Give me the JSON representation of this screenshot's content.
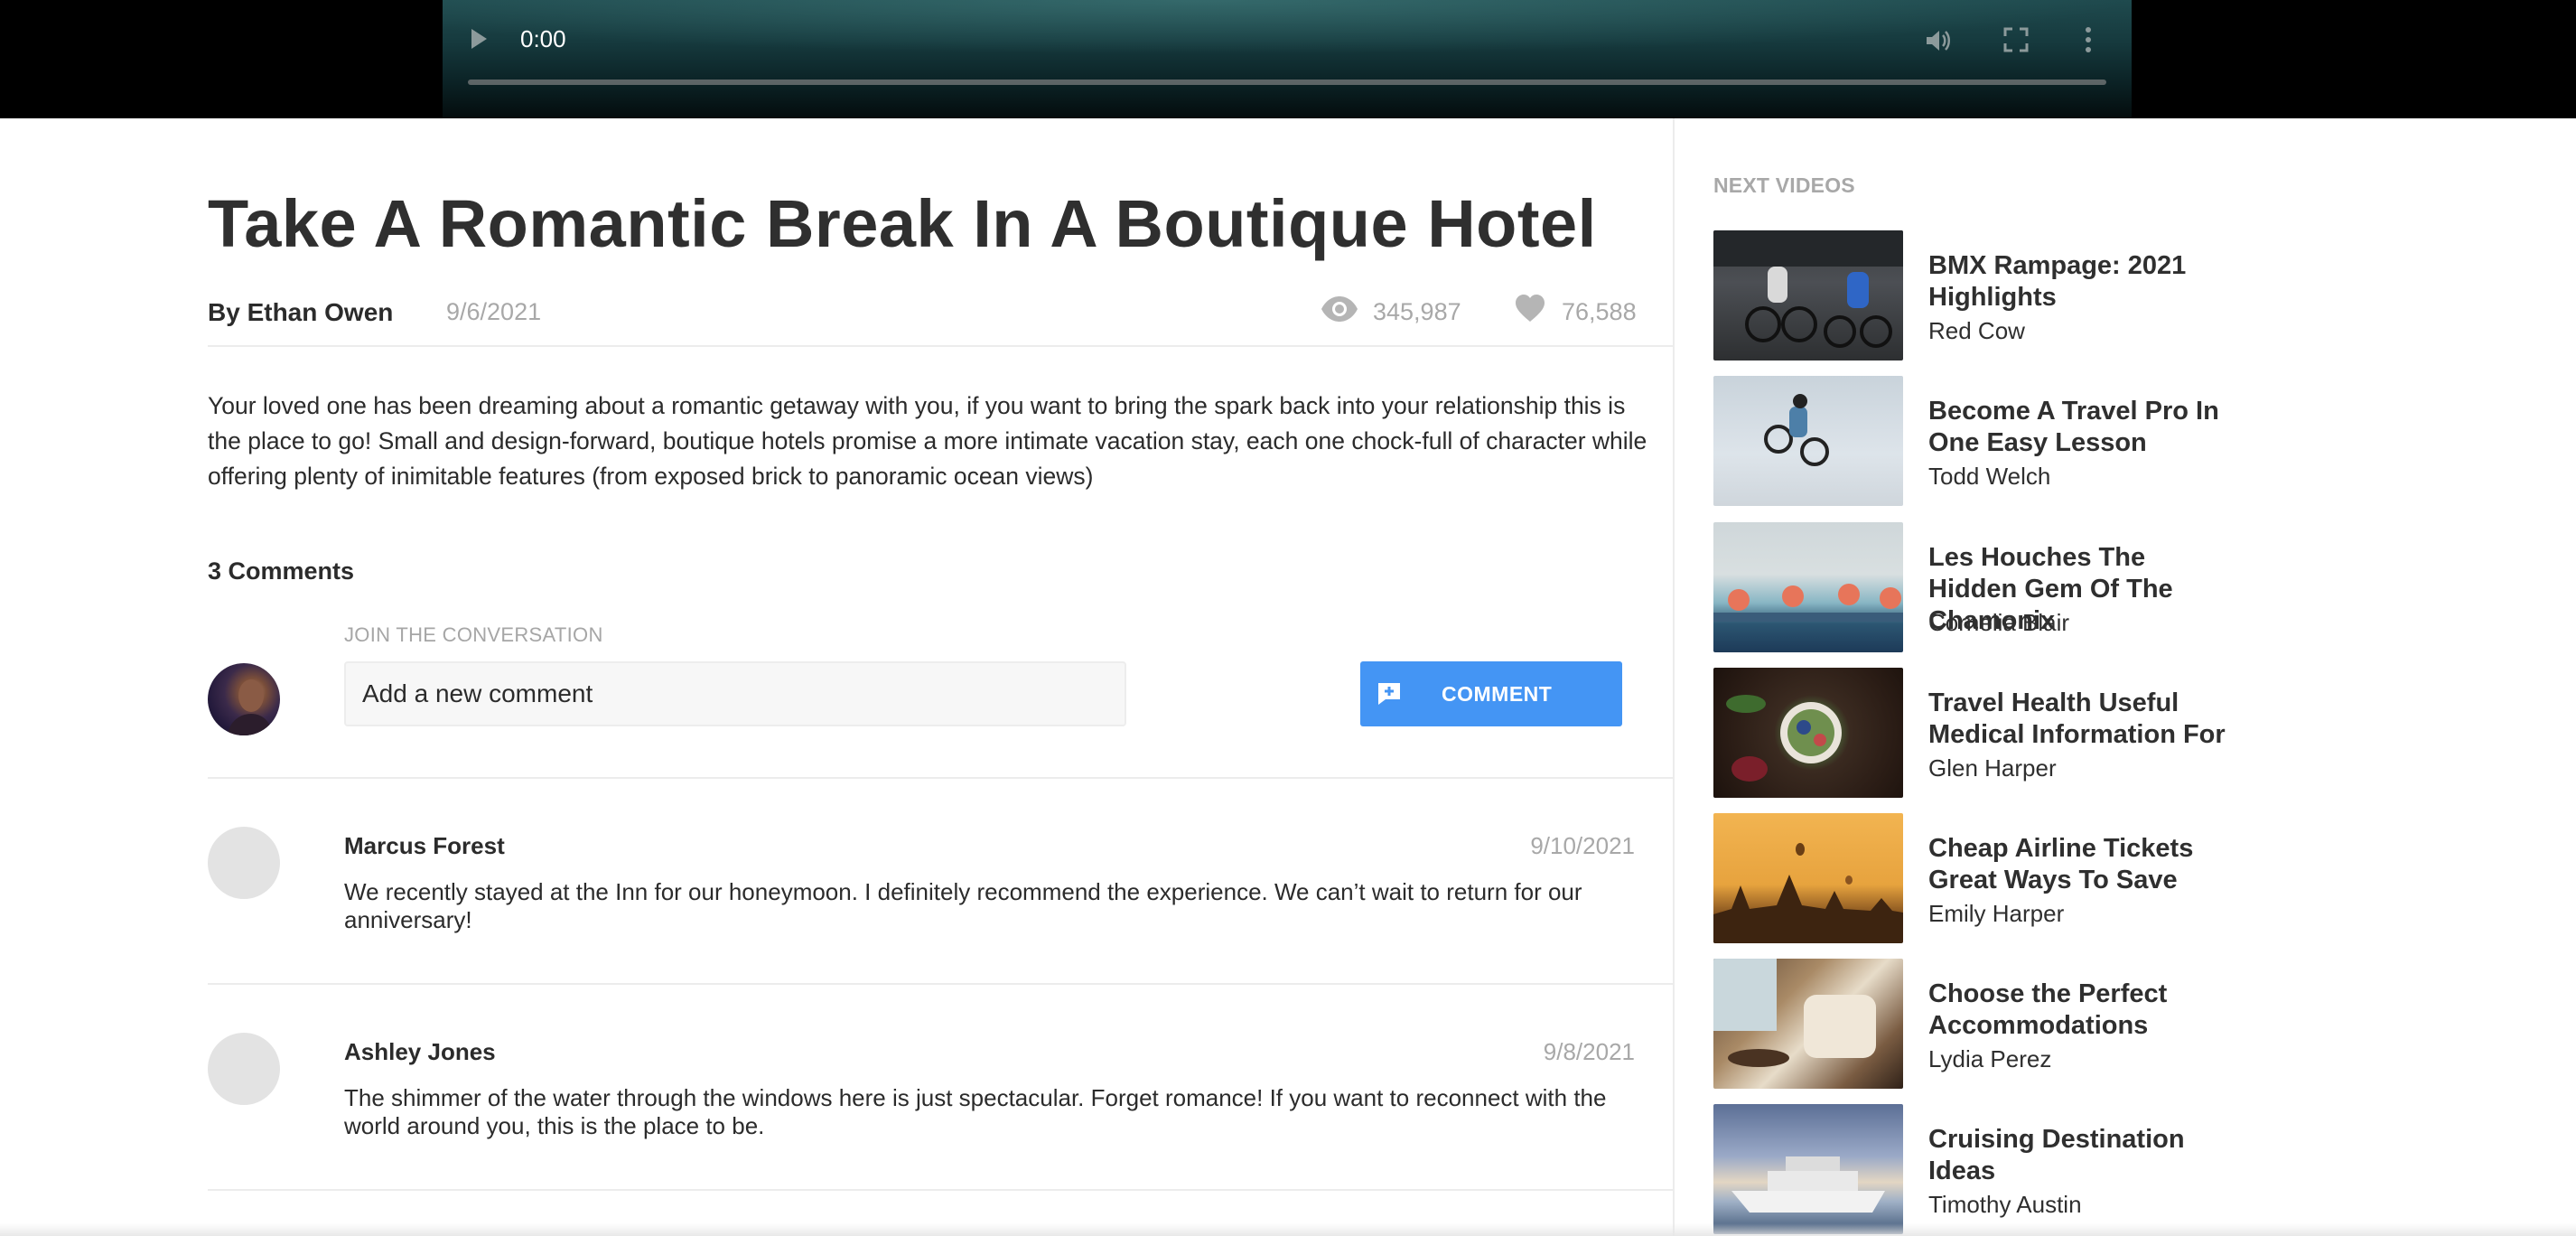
{
  "video": {
    "time": "0:00",
    "progress": 0
  },
  "article": {
    "title": "Take A Romantic Break In A Boutique Hotel",
    "byline": "By Ethan Owen",
    "date": "9/6/2021",
    "views": "345,987",
    "likes": "76,588",
    "body": "Your loved one has been dreaming about a romantic getaway with you, if you want to bring the spark back into your relationship this is the place to go! Small and design-forward, boutique hotels promise a more intimate vacation stay, each one chock-full of character while offering plenty of inimitable features (from exposed brick to panoramic ocean views)"
  },
  "comments": {
    "count_label": "3 Comments",
    "join_label": "JOIN THE CONVERSATION",
    "input_placeholder": "Add a new comment",
    "button_label": "COMMENT",
    "items": [
      {
        "name": "Marcus Forest",
        "date": "9/10/2021",
        "text": "We recently stayed at the Inn for our honeymoon. I definitely recommend the experience. We can’t wait to return for our anniversary!"
      },
      {
        "name": "Ashley Jones",
        "date": "9/8/2021",
        "text": "The shimmer of the water through the windows here is just spectacular. Forget romance! If you want to reconnect with the world around you, this is the place to be."
      }
    ]
  },
  "sidebar": {
    "label": "NEXT VIDEOS",
    "items": [
      {
        "title": "BMX Rampage: 2021 Highlights",
        "author": "Red Cow"
      },
      {
        "title": "Become A Travel Pro In One Easy Lesson",
        "author": "Todd Welch"
      },
      {
        "title": "Les Houches The Hidden Gem Of The Chamonix",
        "author": "Cornelia Blair"
      },
      {
        "title": "Travel Health Useful Medical Information For",
        "author": "Glen Harper"
      },
      {
        "title": "Cheap Airline Tickets Great Ways To Save",
        "author": "Emily Harper"
      },
      {
        "title": "Choose the Perfect Accommodations",
        "author": "Lydia Perez"
      },
      {
        "title": "Cruising Destination Ideas",
        "author": "Timothy Austin"
      }
    ]
  },
  "colors": {
    "accent": "#4495f4",
    "muted_text": "#a8a8a8",
    "body_text": "#2b2b2b",
    "divider": "#ececec"
  },
  "icons": [
    "play-icon",
    "volume-icon",
    "fullscreen-icon",
    "more-options-icon",
    "eye-icon",
    "heart-icon",
    "add-comment-icon"
  ]
}
